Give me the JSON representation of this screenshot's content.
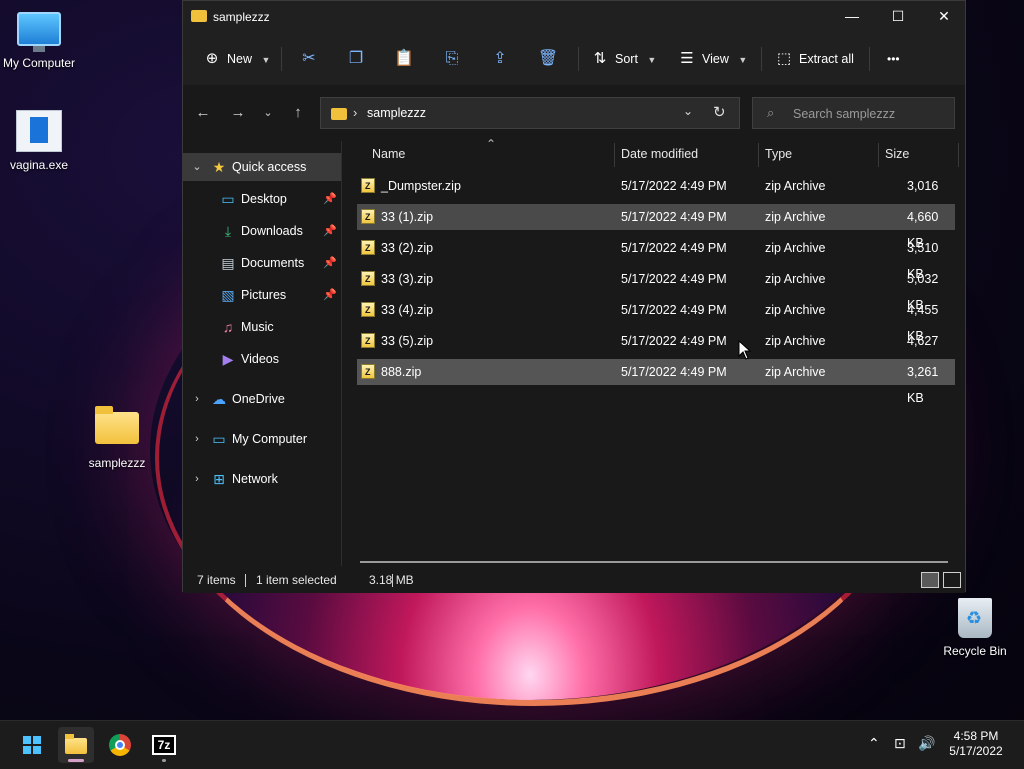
{
  "desktop": {
    "icons": [
      {
        "label": "My Computer"
      },
      {
        "label": "vagina.exe"
      },
      {
        "label": "samplezzz"
      },
      {
        "label": "Recycle Bin"
      }
    ]
  },
  "window": {
    "title": "samplezzz",
    "controls": {
      "minimize": "—",
      "maximize": "☐",
      "close": "✕"
    },
    "toolbar": {
      "new_label": "New",
      "sort_label": "Sort",
      "view_label": "View",
      "extract_label": "Extract all",
      "more_label": "•••"
    },
    "address": {
      "crumb": "samplezzz"
    },
    "search": {
      "placeholder": "Search samplezzz"
    },
    "nav": {
      "quick_access": "Quick access",
      "desktop": "Desktop",
      "downloads": "Downloads",
      "documents": "Documents",
      "pictures": "Pictures",
      "music": "Music",
      "videos": "Videos",
      "onedrive": "OneDrive",
      "my_computer": "My Computer",
      "network": "Network"
    },
    "columns": {
      "name": "Name",
      "date": "Date modified",
      "type": "Type",
      "size": "Size"
    },
    "files": [
      {
        "name": "_Dumpster.zip",
        "date": "5/17/2022 4:49 PM",
        "type": "zip Archive",
        "size": "3,016 KB"
      },
      {
        "name": "33 (1).zip",
        "date": "5/17/2022 4:49 PM",
        "type": "zip Archive",
        "size": "4,660 KB"
      },
      {
        "name": "33 (2).zip",
        "date": "5/17/2022 4:49 PM",
        "type": "zip Archive",
        "size": "3,510 KB"
      },
      {
        "name": "33 (3).zip",
        "date": "5/17/2022 4:49 PM",
        "type": "zip Archive",
        "size": "5,032 KB"
      },
      {
        "name": "33 (4).zip",
        "date": "5/17/2022 4:49 PM",
        "type": "zip Archive",
        "size": "4,455 KB"
      },
      {
        "name": "33 (5).zip",
        "date": "5/17/2022 4:49 PM",
        "type": "zip Archive",
        "size": "4,627 KB"
      },
      {
        "name": "888.zip",
        "date": "5/17/2022 4:49 PM",
        "type": "zip Archive",
        "size": "3,261 KB"
      }
    ],
    "status": {
      "items": "7 items",
      "selected": "1 item selected",
      "size": "3.18 MB"
    }
  },
  "taskbar": {
    "clock_time": "4:58 PM",
    "clock_date": "5/17/2022",
    "sevenz_label": "7z"
  },
  "colors": {
    "accent": "#4cc2ff",
    "folder": "#f2c13c",
    "selection": "#4a4a4a"
  }
}
